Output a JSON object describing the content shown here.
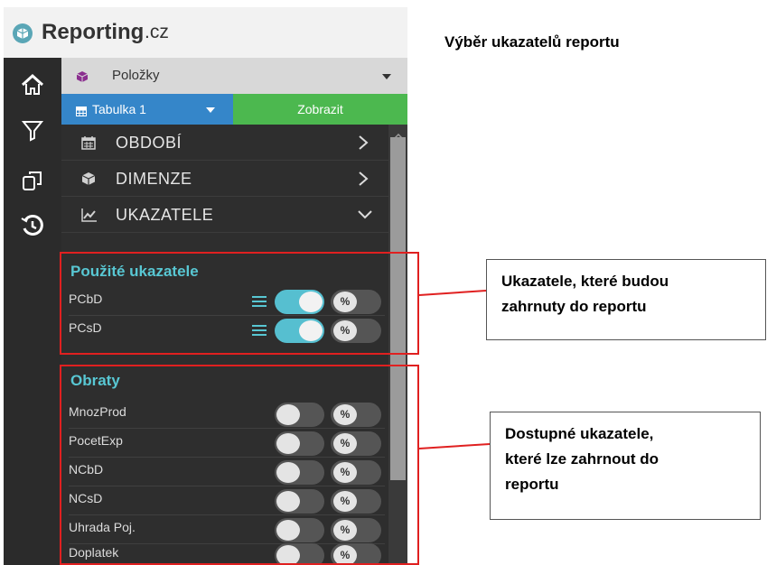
{
  "app": {
    "logo_text": "Reporting",
    "logo_suffix": ".cz"
  },
  "rail": {
    "icons": [
      "home-icon",
      "filter-icon",
      "copy-icon",
      "history-icon"
    ]
  },
  "panel": {
    "items_dropdown": {
      "label": "Položky",
      "icon": "cube-icon"
    },
    "table_select": {
      "label": "Tabulka 1",
      "icon": "table-icon"
    },
    "show_button": {
      "label": "Zobrazit",
      "color": "#4cb84f"
    },
    "sections": [
      {
        "label": "OBDOBÍ",
        "icon": "calendar-icon",
        "state": "collapsed"
      },
      {
        "label": "DIMENZE",
        "icon": "cube-icon",
        "state": "collapsed"
      },
      {
        "label": "UKAZATELE",
        "icon": "chart-line-icon",
        "state": "expanded"
      }
    ],
    "used_group": {
      "title": "Použité ukazatele",
      "metrics": [
        {
          "name": "PCbD",
          "enabled": true,
          "percent": "%"
        },
        {
          "name": "PCsD",
          "enabled": true,
          "percent": "%"
        }
      ]
    },
    "available_group": {
      "title": "Obraty",
      "metrics": [
        {
          "name": "MnozProd",
          "enabled": false,
          "percent": "%"
        },
        {
          "name": "PocetExp",
          "enabled": false,
          "percent": "%"
        },
        {
          "name": "NCbD",
          "enabled": false,
          "percent": "%"
        },
        {
          "name": "NCsD",
          "enabled": false,
          "percent": "%"
        },
        {
          "name": "Uhrada Poj.",
          "enabled": false,
          "percent": "%"
        },
        {
          "name": "Doplatek",
          "enabled": false,
          "percent": "%"
        }
      ]
    }
  },
  "annotations": {
    "heading": "Výběr ukazatelů reportu",
    "used_callout": {
      "line1": "Ukazatele, které budou",
      "line2": "zahrnuty do reportu"
    },
    "available_callout": {
      "line1": "Dostupné ukazatele,",
      "line2": "které lze zahrnout do",
      "line3": "reportu"
    }
  },
  "colors": {
    "accent_teal": "#58c7d3",
    "toggle_on": "#56bfd0",
    "table_blue": "#3586c9",
    "highlight_red": "#e02020"
  }
}
